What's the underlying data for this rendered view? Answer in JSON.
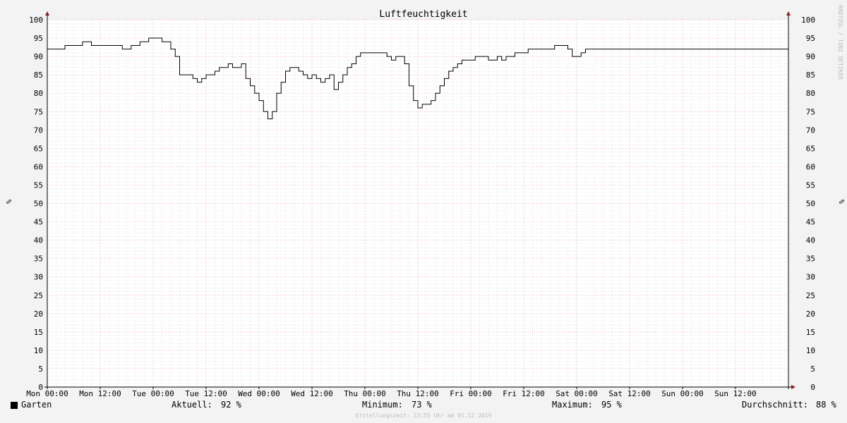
{
  "chart_data": {
    "type": "line",
    "title": "Luftfeuchtigkeit",
    "ylabel_left": "%",
    "ylabel_right": "%",
    "ylim": [
      0,
      100
    ],
    "y_ticks": [
      0,
      5,
      10,
      15,
      20,
      25,
      30,
      35,
      40,
      45,
      50,
      55,
      60,
      65,
      70,
      75,
      80,
      85,
      90,
      95,
      100
    ],
    "x_hours_range": [
      0,
      168
    ],
    "x_tick_labels": [
      "Mon 00:00",
      "Mon 12:00",
      "Tue 00:00",
      "Tue 12:00",
      "Wed 00:00",
      "Wed 12:00",
      "Thu 00:00",
      "Thu 12:00",
      "Fri 00:00",
      "Fri 12:00",
      "Sat 00:00",
      "Sat 12:00",
      "Sun 00:00",
      "Sun 12:00"
    ],
    "grid": true,
    "line_color": "#000000",
    "series": [
      {
        "name": "Garten",
        "x": [
          0,
          3,
          4,
          8,
          10,
          12,
          17,
          17.5,
          18,
          19,
          20,
          21,
          23,
          25,
          26,
          28,
          29,
          30,
          33,
          34,
          35,
          36,
          38,
          39,
          40,
          41,
          42,
          44,
          45,
          46,
          47,
          48,
          49,
          50,
          51,
          52,
          53,
          54,
          55,
          56,
          57,
          58,
          59,
          60,
          61,
          62,
          63,
          64,
          65,
          66,
          67,
          68,
          69,
          70,
          71,
          72,
          73,
          74,
          75,
          76,
          77,
          78,
          79,
          80,
          81,
          82,
          83,
          84,
          85,
          86,
          87,
          88,
          89,
          90,
          91,
          92,
          93,
          94,
          96,
          97,
          98,
          100,
          101,
          102,
          103,
          104,
          105,
          106,
          107,
          108,
          109,
          110,
          111,
          112,
          113,
          114,
          115,
          116,
          117,
          118,
          119,
          120,
          121,
          122,
          123,
          124,
          125,
          126,
          127,
          128,
          129,
          130,
          131,
          132,
          133,
          134,
          135,
          136,
          137,
          138,
          139,
          140,
          142,
          144,
          146,
          148,
          150,
          153,
          154,
          155,
          156,
          157,
          158,
          159,
          160,
          161,
          162,
          163,
          164,
          165,
          166,
          167,
          168
        ],
        "values": [
          92,
          92,
          93,
          94,
          93,
          93,
          92,
          92,
          92,
          93,
          93,
          94,
          95,
          95,
          94,
          92,
          90,
          85,
          84,
          83,
          84,
          85,
          86,
          87,
          87,
          88,
          87,
          88,
          84,
          82,
          80,
          78,
          75,
          73,
          75,
          80,
          83,
          86,
          87,
          87,
          86,
          85,
          84,
          85,
          84,
          83,
          84,
          85,
          81,
          83,
          85,
          87,
          88,
          90,
          91,
          91,
          91,
          91,
          91,
          91,
          90,
          89,
          90,
          90,
          88,
          82,
          78,
          76,
          77,
          77,
          78,
          80,
          82,
          84,
          86,
          87,
          88,
          89,
          89,
          90,
          90,
          89,
          89,
          90,
          89,
          90,
          90,
          91,
          91,
          91,
          92,
          92,
          92,
          92,
          92,
          92,
          93,
          93,
          93,
          92,
          90,
          90,
          91,
          92,
          92,
          92,
          92,
          92,
          92,
          92,
          92,
          92,
          92,
          92,
          92,
          92,
          92,
          92,
          92,
          92,
          92,
          92,
          92,
          92,
          92,
          92,
          92,
          92,
          92,
          92,
          92,
          92,
          92,
          92,
          92,
          92,
          92,
          92,
          92,
          92,
          92,
          92,
          92
        ]
      }
    ],
    "watermark": "RRDTOOL / TOBI OETIKER",
    "credit": "Erstellungszeit: 23:55 Uhr am 01.12.2019"
  },
  "legend": {
    "series_name": "Garten",
    "aktuell_label": "Aktuell:",
    "aktuell_value": "92 %",
    "minimum_label": "Minimum:",
    "minimum_value": "73 %",
    "maximum_label": "Maximum:",
    "maximum_value": "95 %",
    "durchschnitt_label": "Durchschnitt:",
    "durchschnitt_value": "88 %"
  }
}
